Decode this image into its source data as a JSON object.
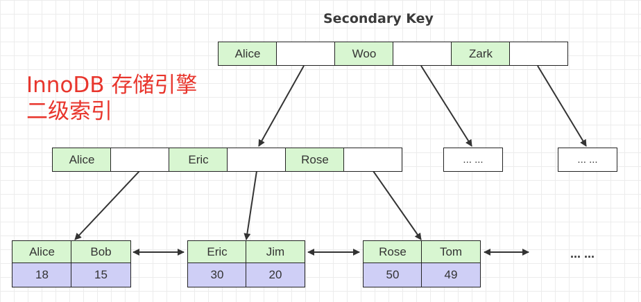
{
  "title": "Secondary Key",
  "label_lines": [
    "InnoDB 存储引擎",
    "二级索引"
  ],
  "colors": {
    "key_cell": "#d8f6d1",
    "pointer_cell": "#ffffff",
    "value_cell": "#cfcff6",
    "label": "#e8352c"
  },
  "root": {
    "keys": [
      "Alice",
      "Woo",
      "Zark"
    ]
  },
  "internal": [
    {
      "keys": [
        "Alice",
        "Eric",
        "Rose"
      ]
    },
    {
      "placeholder": "... ..."
    },
    {
      "placeholder": "... ..."
    }
  ],
  "leaves": [
    {
      "keys": [
        "Alice",
        "Bob"
      ],
      "values": [
        "18",
        "15"
      ]
    },
    {
      "keys": [
        "Eric",
        "Jim"
      ],
      "values": [
        "30",
        "20"
      ]
    },
    {
      "keys": [
        "Rose",
        "Tom"
      ],
      "values": [
        "50",
        "49"
      ]
    }
  ],
  "leaf_ellipsis": "... ..."
}
